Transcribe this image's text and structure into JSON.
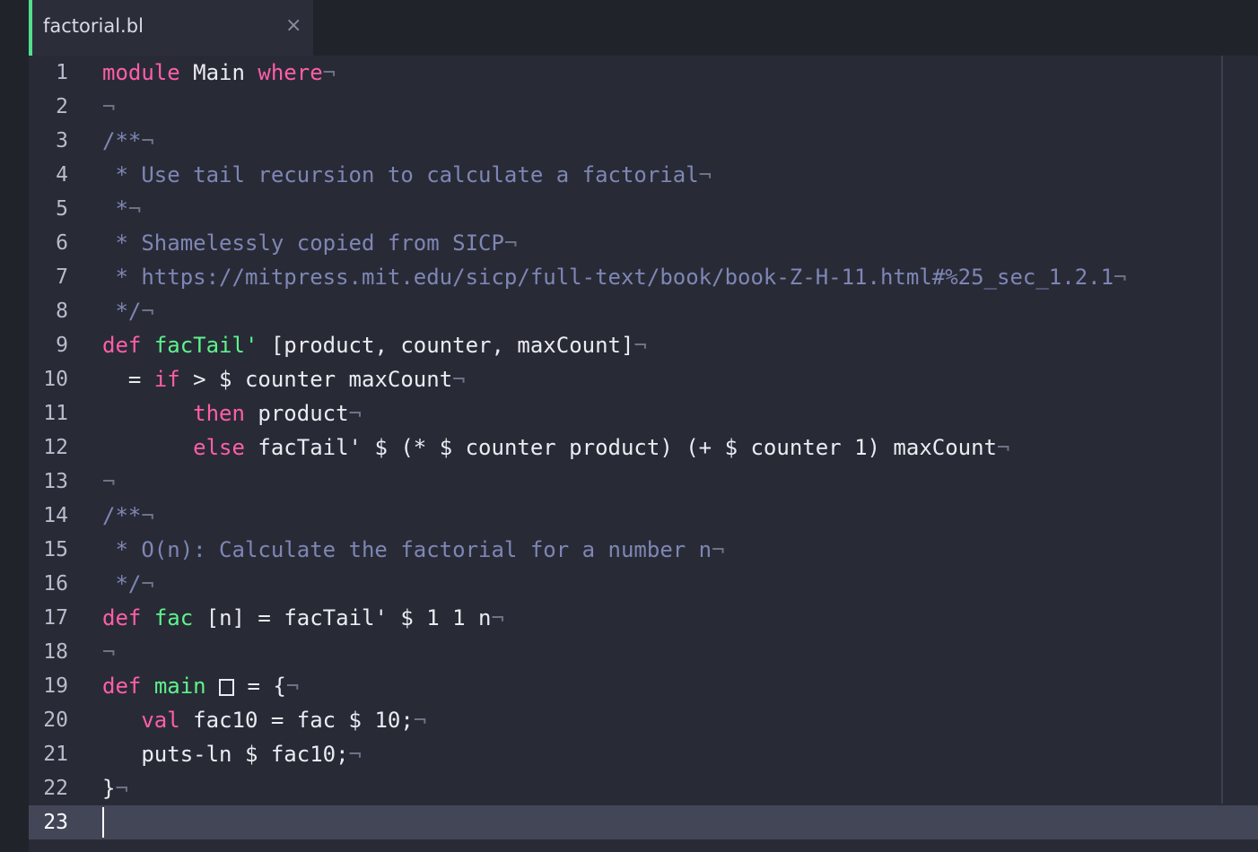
{
  "tab": {
    "title": "factorial.bl",
    "close_glyph": "×"
  },
  "editor": {
    "current_line": 23,
    "eol_marker": "¬",
    "lines": [
      {
        "n": "1",
        "tokens": [
          [
            "kw",
            "module"
          ],
          [
            "tx",
            " Main "
          ],
          [
            "kw",
            "where"
          ],
          [
            "ws",
            "¬"
          ]
        ]
      },
      {
        "n": "2",
        "tokens": [
          [
            "ws",
            "¬"
          ]
        ]
      },
      {
        "n": "3",
        "tokens": [
          [
            "cm",
            "/**"
          ],
          [
            "ws",
            "¬"
          ]
        ]
      },
      {
        "n": "4",
        "tokens": [
          [
            "cm",
            " * Use tail recursion to calculate a factorial"
          ],
          [
            "ws",
            "¬"
          ]
        ]
      },
      {
        "n": "5",
        "tokens": [
          [
            "cm",
            " *"
          ],
          [
            "ws",
            "¬"
          ]
        ]
      },
      {
        "n": "6",
        "tokens": [
          [
            "cm",
            " * Shamelessly copied from SICP"
          ],
          [
            "ws",
            "¬"
          ]
        ]
      },
      {
        "n": "7",
        "tokens": [
          [
            "cm",
            " * https://mitpress.mit.edu/sicp/full-text/book/book-Z-H-11.html#%25_sec_1.2.1"
          ],
          [
            "ws",
            "¬"
          ]
        ]
      },
      {
        "n": "8",
        "tokens": [
          [
            "cm",
            " */"
          ],
          [
            "ws",
            "¬"
          ]
        ]
      },
      {
        "n": "9",
        "tokens": [
          [
            "kw",
            "def"
          ],
          [
            "tx",
            " "
          ],
          [
            "fn",
            "facTail'"
          ],
          [
            "tx",
            " [product, counter, maxCount]"
          ],
          [
            "ws",
            "¬"
          ]
        ]
      },
      {
        "n": "10",
        "tokens": [
          [
            "tx",
            "  = "
          ],
          [
            "kw",
            "if"
          ],
          [
            "tx",
            " > $ counter maxCount"
          ],
          [
            "ws",
            "¬"
          ]
        ]
      },
      {
        "n": "11",
        "tokens": [
          [
            "tx",
            "       "
          ],
          [
            "kw",
            "then"
          ],
          [
            "tx",
            " product"
          ],
          [
            "ws",
            "¬"
          ]
        ]
      },
      {
        "n": "12",
        "tokens": [
          [
            "tx",
            "       "
          ],
          [
            "kw",
            "else"
          ],
          [
            "tx",
            " facTail' $ (* $ counter product) (+ $ counter 1) maxCount"
          ],
          [
            "ws",
            "¬"
          ]
        ]
      },
      {
        "n": "13",
        "tokens": [
          [
            "ws",
            "¬"
          ]
        ]
      },
      {
        "n": "14",
        "tokens": [
          [
            "cm",
            "/**"
          ],
          [
            "ws",
            "¬"
          ]
        ]
      },
      {
        "n": "15",
        "tokens": [
          [
            "cm",
            " * O(n): Calculate the factorial for a number n"
          ],
          [
            "ws",
            "¬"
          ]
        ]
      },
      {
        "n": "16",
        "tokens": [
          [
            "cm",
            " */"
          ],
          [
            "ws",
            "¬"
          ]
        ]
      },
      {
        "n": "17",
        "tokens": [
          [
            "kw",
            "def"
          ],
          [
            "tx",
            " "
          ],
          [
            "fn",
            "fac"
          ],
          [
            "tx",
            " [n] = facTail' $ 1 1 n"
          ],
          [
            "ws",
            "¬"
          ]
        ]
      },
      {
        "n": "18",
        "tokens": [
          [
            "ws",
            "¬"
          ]
        ]
      },
      {
        "n": "19",
        "tokens": [
          [
            "kw",
            "def"
          ],
          [
            "tx",
            " "
          ],
          [
            "fn",
            "main"
          ],
          [
            "tx",
            " "
          ],
          [
            "box",
            ""
          ],
          [
            "tx",
            " = {"
          ],
          [
            "ws",
            "¬"
          ]
        ]
      },
      {
        "n": "20",
        "tokens": [
          [
            "tx",
            "   "
          ],
          [
            "kw",
            "val"
          ],
          [
            "tx",
            " fac10 = fac $ 10;"
          ],
          [
            "ws",
            "¬"
          ]
        ]
      },
      {
        "n": "21",
        "tokens": [
          [
            "tx",
            "   puts-ln $ fac10;"
          ],
          [
            "ws",
            "¬"
          ]
        ]
      },
      {
        "n": "22",
        "tokens": [
          [
            "tx",
            "}"
          ],
          [
            "ws",
            "¬"
          ]
        ]
      },
      {
        "n": "23",
        "tokens": []
      }
    ]
  }
}
